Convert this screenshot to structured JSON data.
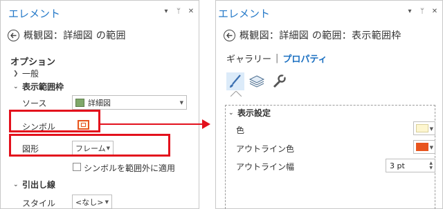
{
  "left_panel": {
    "title": "エレメント",
    "breadcrumb": "概観図：詳細図 の範囲",
    "options_header": "オプション",
    "general_item": "一般",
    "extent_frame_item": "表示範囲枠",
    "source_label": "ソース",
    "source_value": "詳細図",
    "symbol_label": "シンボル",
    "shape_label": "図形",
    "shape_value": "フレーム",
    "apply_outside_label": "シンボルを範囲外に適用",
    "leader_header": "引出し線",
    "style_label": "スタイル",
    "style_value": "<なし>"
  },
  "right_panel": {
    "title": "エレメント",
    "breadcrumb": "概観図：詳細図 の範囲：表示範囲枠",
    "tab_gallery": "ギャラリー",
    "tab_properties": "プロパティ",
    "display_settings_header": "表示設定",
    "color_label": "色",
    "outline_color_label": "アウトライン色",
    "outline_width_label": "アウトライン幅",
    "outline_width_value": "3 pt"
  },
  "colors": {
    "accent_blue": "#2378c8",
    "highlight_red": "#e3101c",
    "outline_orange": "#e8541e",
    "fill_cream": "#fdf6cf"
  },
  "icons": [
    "back-arrow-icon",
    "chevron-right-icon",
    "chevron-down-icon",
    "map-thumbnail-icon",
    "checkbox-icon",
    "paintbrush-icon",
    "layers-icon",
    "wrench-icon",
    "pin-icon",
    "close-icon",
    "dropdown-arrow-icon"
  ]
}
